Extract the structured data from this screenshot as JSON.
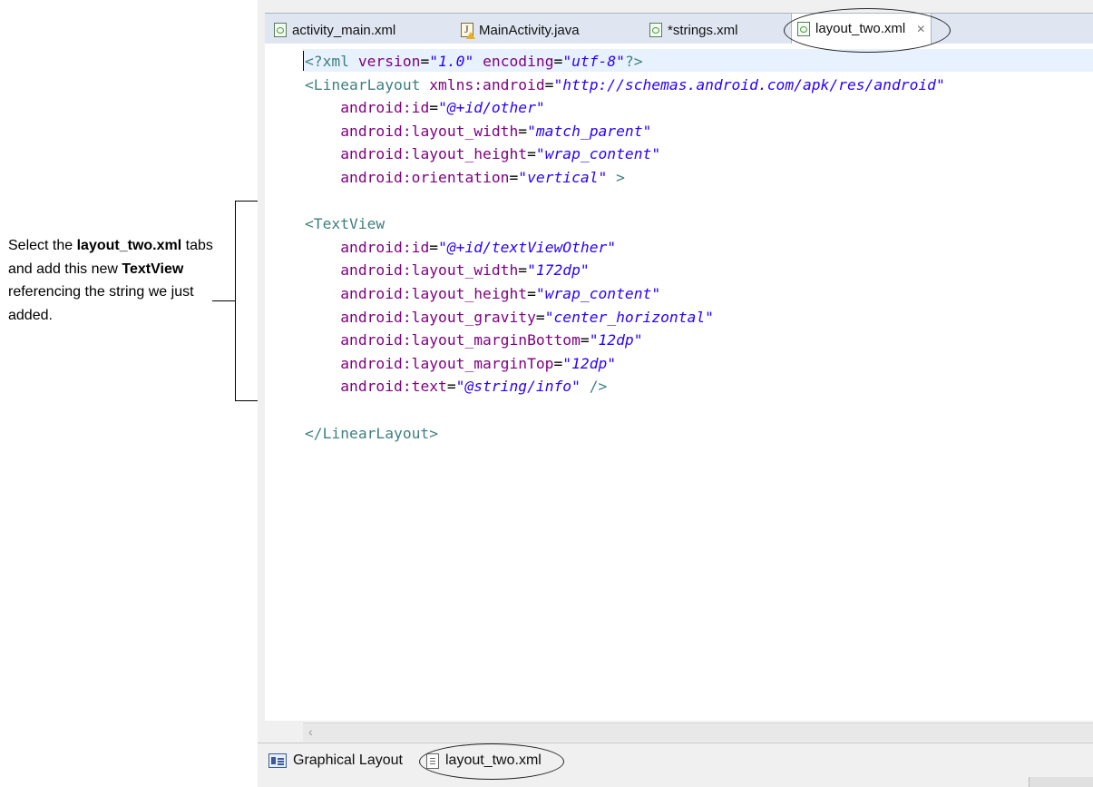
{
  "annotation": {
    "text_parts": [
      {
        "text": "Select the ",
        "bold": false
      },
      {
        "text": "layout_two.xml",
        "bold": true
      },
      {
        "text": " tabs and add this new ",
        "bold": false
      },
      {
        "text": "TextView",
        "bold": true
      },
      {
        "text": " referencing the string we just added.",
        "bold": false
      }
    ]
  },
  "editor_tabs": [
    {
      "label": "activity_main.xml",
      "icon": "xml-file-icon",
      "active": false
    },
    {
      "label": "MainActivity.java",
      "icon": "java-file-warning-icon",
      "active": false
    },
    {
      "label": "*strings.xml",
      "icon": "xml-file-icon",
      "active": false
    },
    {
      "label": "layout_two.xml",
      "icon": "xml-file-icon",
      "active": true,
      "close_icon": "close-icon"
    }
  ],
  "code_lines": [
    [
      [
        "pi",
        "<?xml "
      ],
      [
        "an",
        "version"
      ],
      [
        "",
        "="
      ],
      [
        "av",
        "\"1.0\""
      ],
      [
        "an",
        " encoding"
      ],
      [
        "",
        "="
      ],
      [
        "av",
        "\"utf-8\""
      ],
      [
        "pi",
        "?>"
      ]
    ],
    [
      [
        "tg",
        "<LinearLayout "
      ],
      [
        "an",
        "xmlns:android"
      ],
      [
        "",
        "="
      ],
      [
        "av",
        "\"http://schemas.android.com/apk/res/android\""
      ]
    ],
    [
      [
        "",
        "    "
      ],
      [
        "an",
        "android:id"
      ],
      [
        "",
        "="
      ],
      [
        "av",
        "\"@+id/other\""
      ]
    ],
    [
      [
        "",
        "    "
      ],
      [
        "an",
        "android:layout_width"
      ],
      [
        "",
        "="
      ],
      [
        "av",
        "\"match_parent\""
      ]
    ],
    [
      [
        "",
        "    "
      ],
      [
        "an",
        "android:layout_height"
      ],
      [
        "",
        "="
      ],
      [
        "av",
        "\"wrap_content\""
      ]
    ],
    [
      [
        "",
        "    "
      ],
      [
        "an",
        "android:orientation"
      ],
      [
        "",
        "="
      ],
      [
        "av",
        "\"vertical\""
      ],
      [
        "tg",
        " >"
      ]
    ],
    [],
    [
      [
        "tg",
        "<TextView"
      ]
    ],
    [
      [
        "",
        "    "
      ],
      [
        "an",
        "android:id"
      ],
      [
        "",
        "="
      ],
      [
        "av",
        "\"@+id/textViewOther\""
      ]
    ],
    [
      [
        "",
        "    "
      ],
      [
        "an",
        "android:layout_width"
      ],
      [
        "",
        "="
      ],
      [
        "av",
        "\"172dp\""
      ]
    ],
    [
      [
        "",
        "    "
      ],
      [
        "an",
        "android:layout_height"
      ],
      [
        "",
        "="
      ],
      [
        "av",
        "\"wrap_content\""
      ]
    ],
    [
      [
        "",
        "    "
      ],
      [
        "an",
        "android:layout_gravity"
      ],
      [
        "",
        "="
      ],
      [
        "av",
        "\"center_horizontal\""
      ]
    ],
    [
      [
        "",
        "    "
      ],
      [
        "an",
        "android:layout_marginBottom"
      ],
      [
        "",
        "="
      ],
      [
        "av",
        "\"12dp\""
      ]
    ],
    [
      [
        "",
        "    "
      ],
      [
        "an",
        "android:layout_marginTop"
      ],
      [
        "",
        "="
      ],
      [
        "av",
        "\"12dp\""
      ]
    ],
    [
      [
        "",
        "    "
      ],
      [
        "an",
        "android:text"
      ],
      [
        "",
        "="
      ],
      [
        "av",
        "\"@string/info\""
      ],
      [
        "tg",
        " />"
      ]
    ],
    [],
    [
      [
        "tg",
        "</LinearLayout>"
      ]
    ]
  ],
  "scroll": {
    "left_arrow": "‹"
  },
  "bottom_tabs": [
    {
      "label": "Graphical Layout",
      "icon": "graphical-layout-icon"
    },
    {
      "label": "layout_two.xml",
      "icon": "xml-source-icon"
    }
  ],
  "colors": {
    "tag": "#3f7f7f",
    "attribute": "#7f007f",
    "value": "#2a00ff",
    "current_line": "#e8f2fe"
  }
}
